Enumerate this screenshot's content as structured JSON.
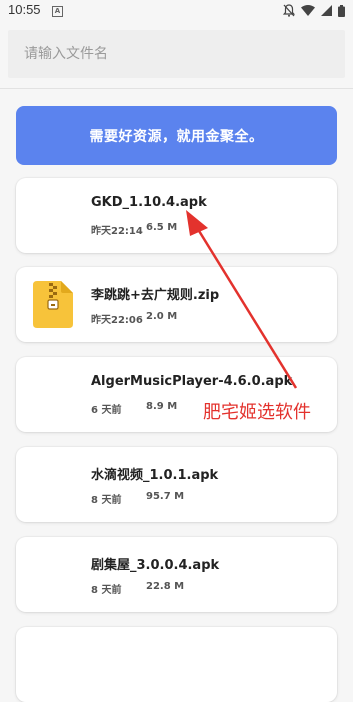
{
  "status_bar": {
    "time": "10:55",
    "notif_letter": "A"
  },
  "search": {
    "placeholder": "请输入文件名"
  },
  "banner": {
    "text": "需要好资源，就用金聚全。"
  },
  "files": [
    {
      "name": "GKD_1.10.4.apk",
      "date": "昨天22:14",
      "size": "6.5 M",
      "icon": "none"
    },
    {
      "name": "李跳跳+去广规则.zip",
      "date": "昨天22:06",
      "size": "2.0 M",
      "icon": "zip-file-icon"
    },
    {
      "name": "AlgerMusicPlayer-4.6.0.apk",
      "date": "6 天前",
      "size": "8.9 M",
      "icon": "none"
    },
    {
      "name": "水滴视频_1.0.1.apk",
      "date": "8 天前",
      "size": "95.7 M",
      "icon": "none"
    },
    {
      "name": "剧集屋_3.0.0.4.apk",
      "date": "8 天前",
      "size": "22.8 M",
      "icon": "none"
    }
  ],
  "annotation": {
    "text": "肥宅姬选软件",
    "color": "#e3322d"
  },
  "colors": {
    "accent": "#5b83ee",
    "background": "#f6f6f6",
    "card": "#ffffff"
  }
}
